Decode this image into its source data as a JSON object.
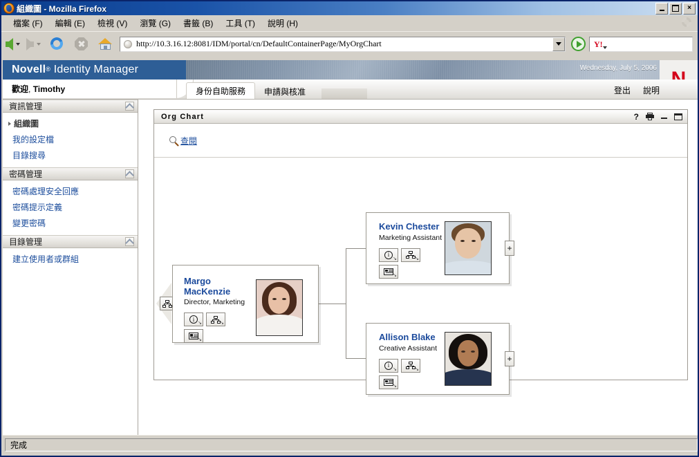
{
  "window": {
    "title": "組織圖 - Mozilla Firefox",
    "minimize_label": "_",
    "maximize_label": "□",
    "close_label": "×"
  },
  "menubar": {
    "items": [
      {
        "label": "檔案 (F)"
      },
      {
        "label": "編輯 (E)"
      },
      {
        "label": "檢視 (V)"
      },
      {
        "label": "瀏覽 (G)"
      },
      {
        "label": "書籤 (B)"
      },
      {
        "label": "工具 (T)"
      },
      {
        "label": "說明 (H)"
      }
    ]
  },
  "toolbar": {
    "back_title": "上一頁",
    "forward_title": "下一頁",
    "reload_title": "重新載入",
    "stop_title": "停止",
    "home_title": "首頁",
    "url": "http://10.3.16.12:8081/IDM/portal/cn/DefaultContainerPage/MyOrgChart",
    "go_title": "前往",
    "search_value": "",
    "search_placeholder": "",
    "search_engine": "Y!"
  },
  "branding": {
    "product_prefix": "Novell",
    "registered_mark": "®",
    "product_name": "Identity Manager",
    "date": "Wednesday, July 5, 2006",
    "logo_letter": "N",
    "brand_blue": "#2e5e96",
    "brand_red": "#d4001a"
  },
  "welcome": {
    "greeting_label": "歡迎",
    "greeting_separator": ", ",
    "user_name": "Timothy",
    "greeting_full": "歡迎, Timothy"
  },
  "tabs": [
    {
      "label": "身份自助服務",
      "active": true
    },
    {
      "label": "申請與核准",
      "active": false
    }
  ],
  "header_links": [
    {
      "label": "登出"
    },
    {
      "label": "說明"
    }
  ],
  "sidebar": {
    "groups": [
      {
        "title": "資訊管理",
        "items": [
          {
            "label": "組織圖",
            "selected": true
          },
          {
            "label": "我的設定檔",
            "selected": false
          },
          {
            "label": "目錄搜尋",
            "selected": false
          }
        ]
      },
      {
        "title": "密碼管理",
        "items": [
          {
            "label": "密碼處理安全回應",
            "selected": false
          },
          {
            "label": "密碼提示定義",
            "selected": false
          },
          {
            "label": "變更密碼",
            "selected": false
          }
        ]
      },
      {
        "title": "目錄管理",
        "items": [
          {
            "label": "建立使用者或群組",
            "selected": false
          }
        ]
      }
    ]
  },
  "portlet": {
    "title": "Org Chart",
    "icons": {
      "help": "?",
      "print": "print-icon",
      "minimize": "minimize-icon",
      "maximize": "maximize-icon"
    },
    "lookup_label": "查閱"
  },
  "org_chart": {
    "root": {
      "name_line1": "Margo",
      "name_line2": "MacKenzie",
      "name_full": "Margo MacKenzie",
      "title": "Director, Marketing",
      "buttons": [
        {
          "icon": "info-icon",
          "carat": "↘"
        },
        {
          "icon": "org-chart-icon",
          "carat": "↘"
        },
        {
          "icon": "id-card-icon",
          "carat": "↘"
        }
      ],
      "parent_nav_icon": "org-chart-icon"
    },
    "children": [
      {
        "name": "Kevin Chester",
        "title": "Marketing Assistant",
        "expand_label": "+",
        "buttons": [
          {
            "icon": "info-icon",
            "carat": "↘"
          },
          {
            "icon": "org-chart-icon",
            "carat": "↘"
          },
          {
            "icon": "id-card-icon",
            "carat": "↘"
          }
        ]
      },
      {
        "name": "Allison Blake",
        "title": "Creative Assistant",
        "expand_label": "+",
        "buttons": [
          {
            "icon": "info-icon",
            "carat": "↘"
          },
          {
            "icon": "org-chart-icon",
            "carat": "↘"
          },
          {
            "icon": "id-card-icon",
            "carat": "↘"
          }
        ]
      }
    ]
  },
  "statusbar": {
    "text": "完成"
  }
}
